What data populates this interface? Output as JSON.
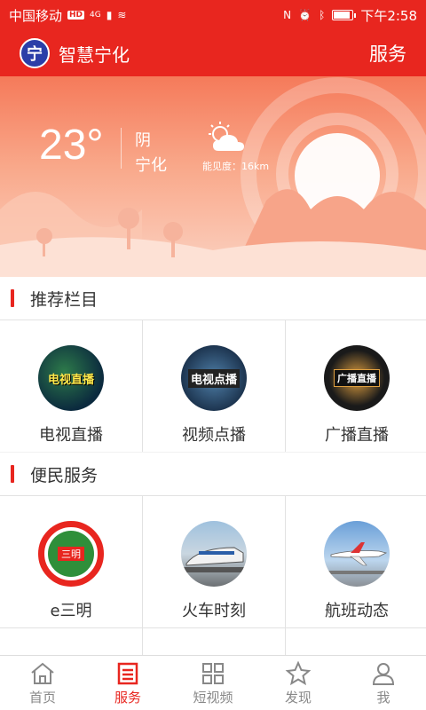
{
  "status_bar": {
    "carrier": "中国移动",
    "hd_badge": "HD",
    "network": "4G",
    "time": "下午2:58"
  },
  "header": {
    "logo_char": "宁",
    "title": "智慧宁化",
    "service_label": "服务"
  },
  "weather": {
    "temperature": "23°",
    "condition": "阴",
    "city": "宁化",
    "visibility": "能见度：16km",
    "icon": "cloudy-sun-icon"
  },
  "sections": [
    {
      "title": "推荐栏目",
      "items": [
        {
          "label": "电视直播",
          "icon": "tv-live-icon",
          "badge": "电视直播"
        },
        {
          "label": "视频点播",
          "icon": "video-on-demand-icon",
          "badge": "电视点播"
        },
        {
          "label": "广播直播",
          "icon": "radio-live-icon",
          "badge": "广播直播"
        }
      ]
    },
    {
      "title": "便民服务",
      "items": [
        {
          "label": "e三明",
          "icon": "e-sanming-icon",
          "badge": "三明"
        },
        {
          "label": "火车时刻",
          "icon": "train-icon"
        },
        {
          "label": "航班动态",
          "icon": "airplane-icon"
        }
      ]
    }
  ],
  "tabs": [
    {
      "label": "首页",
      "icon": "home-icon",
      "active": false
    },
    {
      "label": "服务",
      "icon": "service-icon",
      "active": true
    },
    {
      "label": "短视频",
      "icon": "grid-icon",
      "active": false
    },
    {
      "label": "发现",
      "icon": "discover-icon",
      "active": false
    },
    {
      "label": "我",
      "icon": "user-icon",
      "active": false
    }
  ],
  "colors": {
    "brand": "#e8261f",
    "text": "#333333",
    "inactive": "#888888"
  }
}
